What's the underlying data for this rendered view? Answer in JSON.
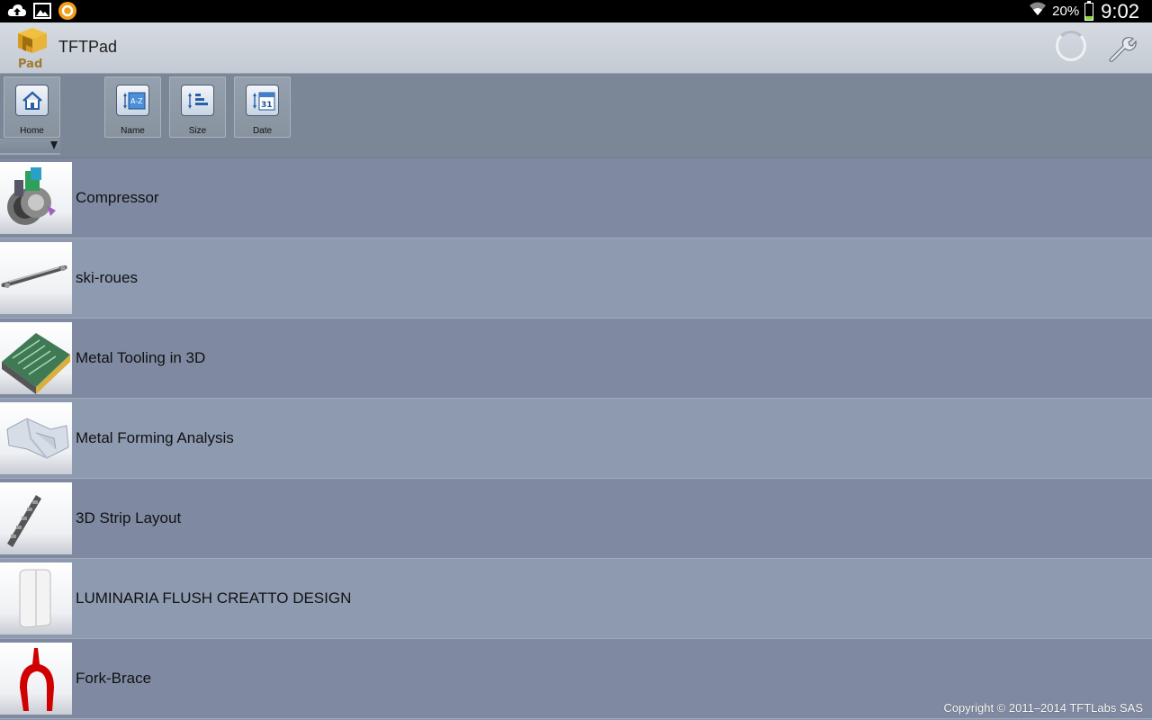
{
  "status_bar": {
    "battery_percent": "20%",
    "time": "9:02",
    "battery_level": 0.2
  },
  "app": {
    "title": "TFTPad",
    "logo_text": "Pad"
  },
  "toolbar": {
    "home_label": "Home",
    "name_label": "Name",
    "size_label": "Size",
    "date_label": "Date",
    "date_icon_day": "31"
  },
  "items": [
    {
      "title": "Compressor"
    },
    {
      "title": "ski-roues"
    },
    {
      "title": "Metal Tooling in 3D"
    },
    {
      "title": "Metal Forming Analysis"
    },
    {
      "title": "3D Strip Layout"
    },
    {
      "title": "LUMINARIA FLUSH CREATTO DESIGN"
    },
    {
      "title": "Fork-Brace"
    }
  ],
  "footer": {
    "copyright": "Copyright © 2011–2014 TFTLabs SAS"
  },
  "colors": {
    "accent_battery": "#8bd43b",
    "fork_red": "#d00000"
  }
}
